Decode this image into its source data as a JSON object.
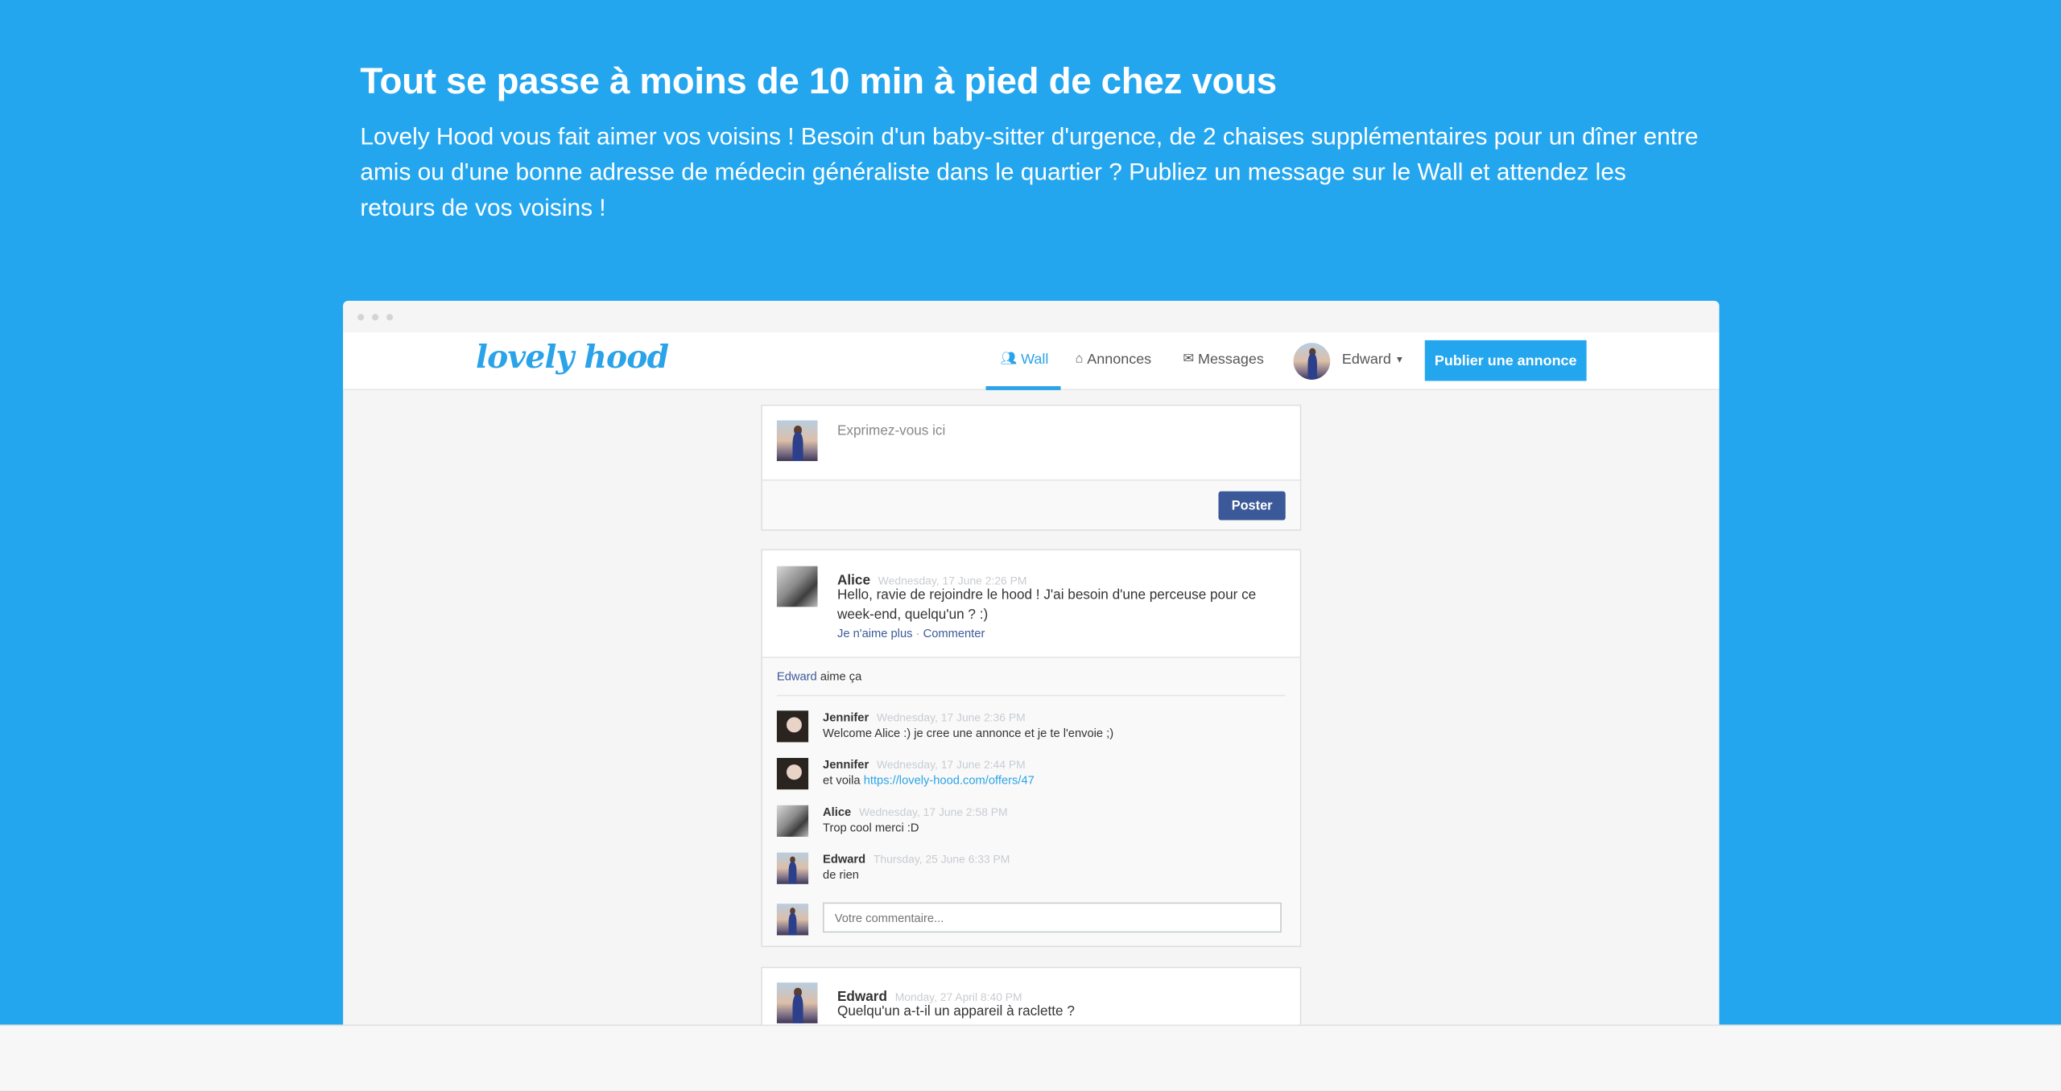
{
  "hero": {
    "title": "Tout se passe à moins de 10 min à pied de chez vous",
    "description": "Lovely Hood vous fait aimer vos voisins ! Besoin d'un baby-sitter d'urgence, de 2 chaises supplémentaires pour un dîner entre amis ou d'une bonne adresse de médecin généraliste dans le quartier ? Publiez un message sur le Wall et attendez les retours de vos voisins !"
  },
  "app": {
    "logo": "lovely hood",
    "nav": {
      "wall": "Wall",
      "annonces": "Annonces",
      "messages": "Messages",
      "user": "Edward",
      "publish": "Publier une annonce"
    },
    "compose": {
      "placeholder": "Exprimez-vous ici",
      "button": "Poster"
    },
    "post1": {
      "author": "Alice",
      "time": "Wednesday, 17 June 2:26 PM",
      "text": "Hello, ravie de rejoindre le hood ! J'ai besoin d'une perceuse pour ce week-end, quelqu'un ? :)",
      "unlike": "Je n'aime plus",
      "dot": "·",
      "comment": "Commenter",
      "likes_name": "Edward",
      "likes_suffix": "aime ça",
      "comments": [
        {
          "author": "Jennifer",
          "time": "Wednesday, 17 June 2:36 PM",
          "text": "Welcome Alice :) je cree une annonce et je te l'envoie ;)"
        },
        {
          "author": "Jennifer",
          "time": "Wednesday, 17 June 2:44 PM",
          "text_prefix": "et voila ",
          "link": "https://lovely-hood.com/offers/47"
        },
        {
          "author": "Alice",
          "time": "Wednesday, 17 June 2:58 PM",
          "text": "Trop cool merci :D"
        },
        {
          "author": "Edward",
          "time": "Thursday, 25 June 6:33 PM",
          "text": "de rien"
        }
      ],
      "comment_placeholder": "Votre commentaire..."
    },
    "post2": {
      "author": "Edward",
      "time": "Monday, 27 April 8:40 PM",
      "text": "Quelqu'un a-t-il un appareil à raclette ?"
    }
  },
  "colors": {
    "background": "#24a6ef",
    "accent": "#2aa3e8",
    "facebook_blue": "#3b5998"
  },
  "icons": {
    "wall": "users-icon",
    "annonces": "home-icon",
    "messages": "envelope-icon",
    "user_menu": "caret-down-icon"
  }
}
